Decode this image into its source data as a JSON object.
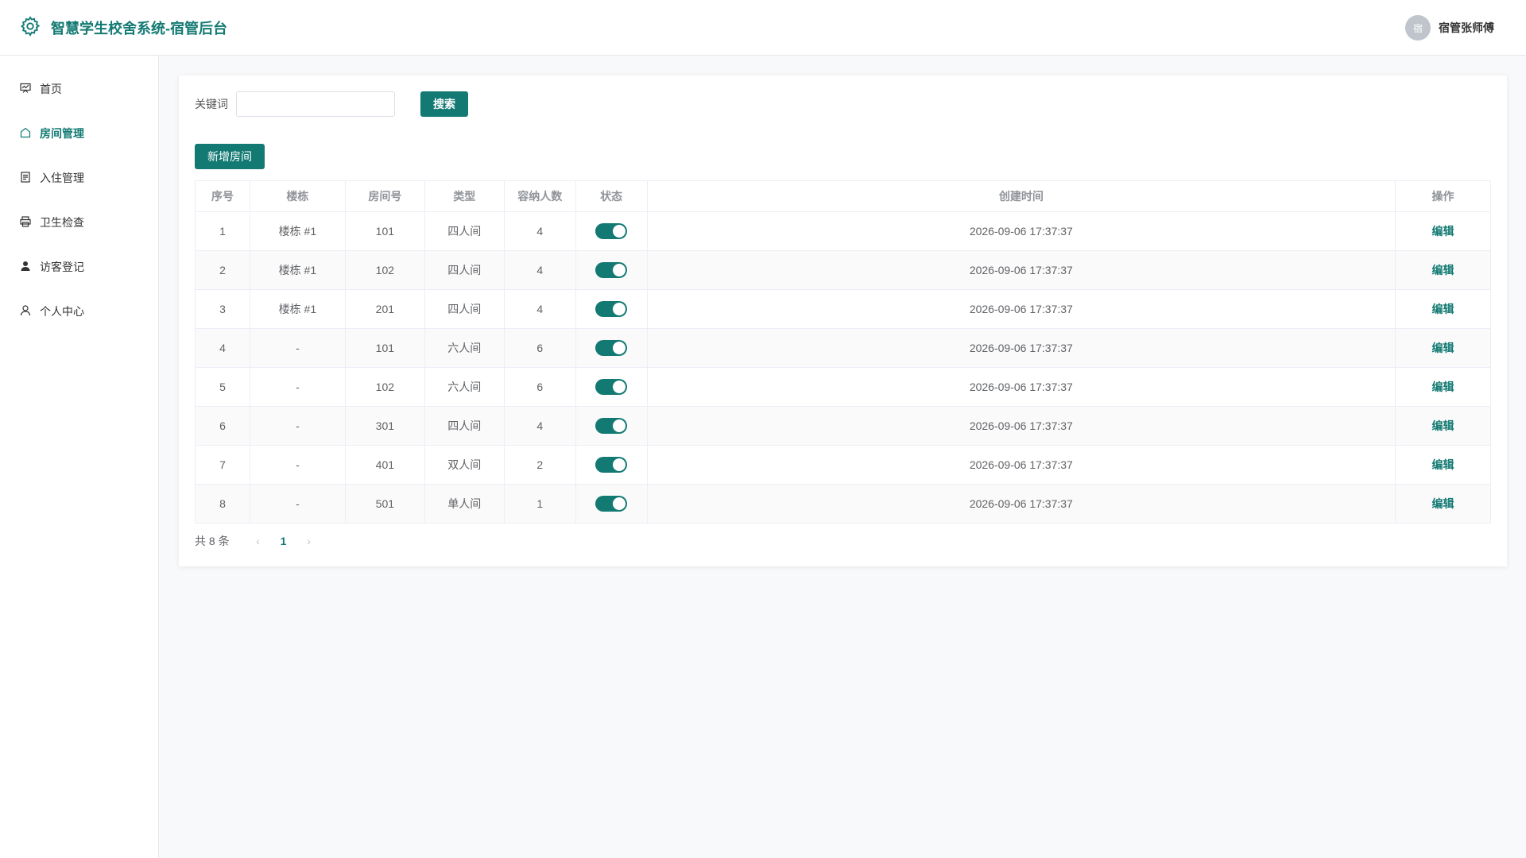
{
  "app": {
    "title": "智慧学生校舍系统-宿管后台",
    "accent_color": "#137a73",
    "logo_icon": "gear-icon"
  },
  "user": {
    "avatar_text": "宿",
    "name": "宿管张师傅"
  },
  "sidebar": {
    "items": [
      {
        "label": "首页",
        "icon": "dashboard-icon",
        "active": false
      },
      {
        "label": "房间管理",
        "icon": "home-icon",
        "active": true
      },
      {
        "label": "入住管理",
        "icon": "document-icon",
        "active": false
      },
      {
        "label": "卫生检查",
        "icon": "printer-icon",
        "active": false
      },
      {
        "label": "访客登记",
        "icon": "user-filled-icon",
        "active": false
      },
      {
        "label": "个人中心",
        "icon": "user-icon",
        "active": false
      }
    ]
  },
  "search": {
    "label": "关键词",
    "value": "",
    "placeholder": "",
    "button_label": "搜索"
  },
  "toolbar": {
    "add_label": "新增房间"
  },
  "table": {
    "headers": [
      "序号",
      "楼栋",
      "房间号",
      "类型",
      "容纳人数",
      "状态",
      "创建时间",
      "操作"
    ],
    "rows": [
      {
        "index": "1",
        "building": "楼栋 #1",
        "room": "101",
        "type": "四人间",
        "capacity": "4",
        "status": true,
        "created": "2026-09-06 17:37:37",
        "action": "编辑"
      },
      {
        "index": "2",
        "building": "楼栋 #1",
        "room": "102",
        "type": "四人间",
        "capacity": "4",
        "status": true,
        "created": "2026-09-06 17:37:37",
        "action": "编辑"
      },
      {
        "index": "3",
        "building": "楼栋 #1",
        "room": "201",
        "type": "四人间",
        "capacity": "4",
        "status": true,
        "created": "2026-09-06 17:37:37",
        "action": "编辑"
      },
      {
        "index": "4",
        "building": "-",
        "room": "101",
        "type": "六人间",
        "capacity": "6",
        "status": true,
        "created": "2026-09-06 17:37:37",
        "action": "编辑"
      },
      {
        "index": "5",
        "building": "-",
        "room": "102",
        "type": "六人间",
        "capacity": "6",
        "status": true,
        "created": "2026-09-06 17:37:37",
        "action": "编辑"
      },
      {
        "index": "6",
        "building": "-",
        "room": "301",
        "type": "四人间",
        "capacity": "4",
        "status": true,
        "created": "2026-09-06 17:37:37",
        "action": "编辑"
      },
      {
        "index": "7",
        "building": "-",
        "room": "401",
        "type": "双人间",
        "capacity": "2",
        "status": true,
        "created": "2026-09-06 17:37:37",
        "action": "编辑"
      },
      {
        "index": "8",
        "building": "-",
        "room": "501",
        "type": "单人间",
        "capacity": "1",
        "status": true,
        "created": "2026-09-06 17:37:37",
        "action": "编辑"
      }
    ]
  },
  "pagination": {
    "total_text": "共 8 条",
    "current_page": "1",
    "prev_icon": "chevron-left-icon",
    "next_icon": "chevron-right-icon"
  }
}
